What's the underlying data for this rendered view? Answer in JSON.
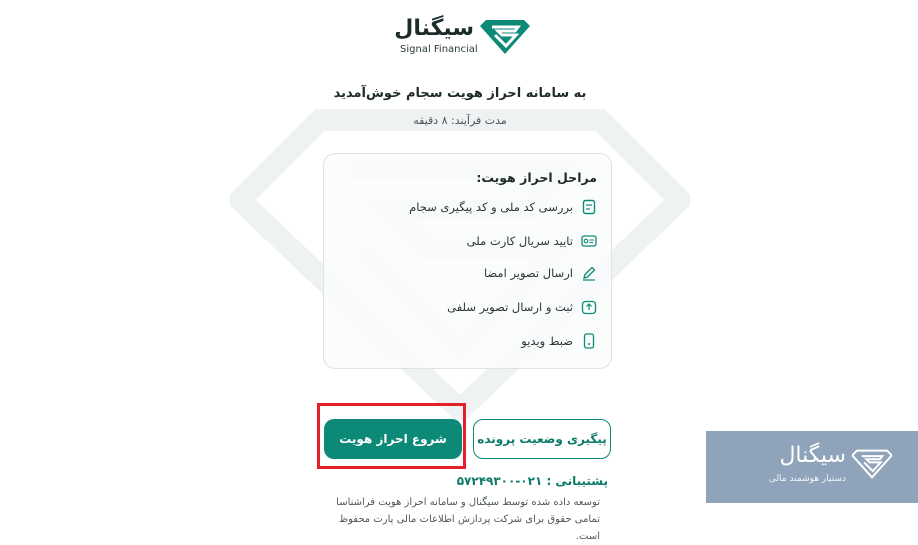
{
  "brand": {
    "name_fa": "سیگنال",
    "name_en": "Signal Financial",
    "accent": "#0d8a77"
  },
  "intro": {
    "title": "به سامانه احراز هویت سجام خوش‌آمدید",
    "duration": "مدت فرآیند: ۸ دقیقه"
  },
  "steps": {
    "title": "مراحل احراز هویت:",
    "items": [
      {
        "label": "بررسی کد ملی و کد پیگیری سجام",
        "icon": "id-card-icon"
      },
      {
        "label": "تایید سریال کارت ملی",
        "icon": "national-card-icon"
      },
      {
        "label": "ارسال تصویر امضا",
        "icon": "pen-icon"
      },
      {
        "label": "ثبت و ارسال تصویر سلفی",
        "icon": "selfie-upload-icon"
      },
      {
        "label": "ضبط ویدیو",
        "icon": "phone-video-icon"
      }
    ]
  },
  "actions": {
    "start_label": "شروع احراز هویت",
    "track_label": "پیگیری وضعیت پرونده"
  },
  "support": {
    "label": "پشتیبانی : ۰۲۱-۵۷۲۴۹۳۰۰"
  },
  "footer": {
    "line1": "توسعه داده شده توسط سیگنال و سامانه احراز هویت فراشناسا",
    "line2": "تمامی حقوق برای شرکت پردازش اطلاعات مالی پارت محفوظ است."
  },
  "banner": {
    "title": "سیگنال",
    "subtitle": "دستیار هوشمند مالی",
    "color": "#8fa4bb"
  }
}
